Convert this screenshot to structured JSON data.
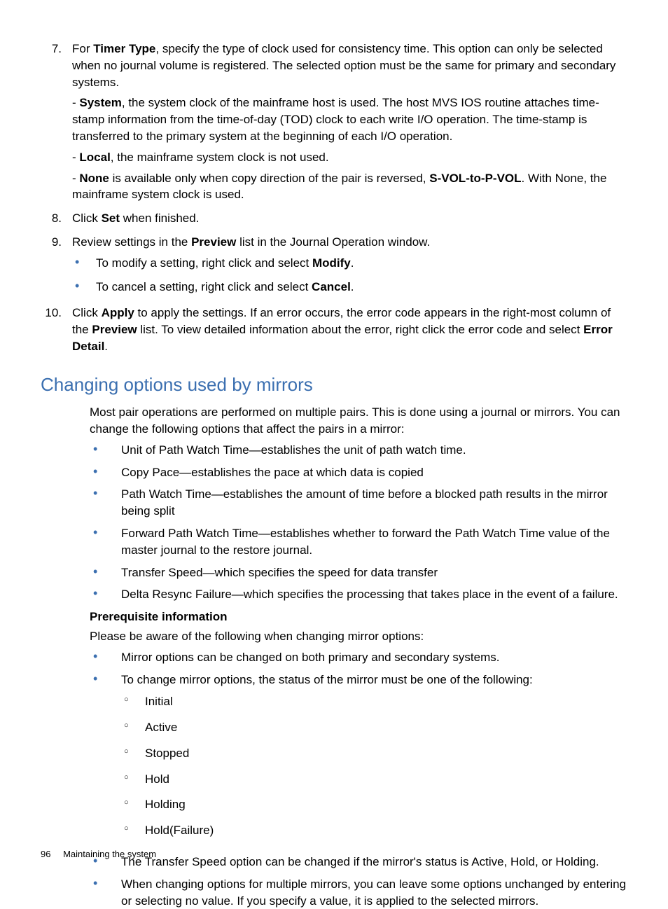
{
  "list7": {
    "num": "7.",
    "p1a": "For ",
    "p1b": "Timer Type",
    "p1c": ", specify the type of clock used for consistency time. This option can only be selected when no journal volume is registered. The selected option must be the same for primary and secondary systems.",
    "p2a": "- ",
    "p2b": "System",
    "p2c": ", the system clock of the mainframe host is used. The host MVS IOS routine attaches time-stamp information from the time-of-day (TOD) clock to each write I/O operation. The time-stamp is transferred to the primary system at the beginning of each I/O operation.",
    "p3a": "- ",
    "p3b": "Local",
    "p3c": ", the mainframe system clock is not used.",
    "p4a": "- ",
    "p4b": "None",
    "p4c": " is available only when copy direction of the pair is reversed, ",
    "p4d": "S-VOL-to-P-VOL",
    "p4e": ". With None, the mainframe system clock is used."
  },
  "list8": {
    "num": "8.",
    "t1": "Click ",
    "t2": "Set",
    "t3": " when finished."
  },
  "list9": {
    "num": "9.",
    "t1": "Review settings in the ",
    "t2": "Preview",
    "t3": " list in the Journal Operation window.",
    "sub1a": "To modify a setting, right click and select ",
    "sub1b": "Modify",
    "sub1c": ".",
    "sub2a": "To cancel a setting, right click and select ",
    "sub2b": "Cancel",
    "sub2c": "."
  },
  "list10": {
    "num": "10.",
    "t1": "Click ",
    "t2": "Apply",
    "t3": " to apply the settings. If an error occurs, the error code appears in the right-most column of the ",
    "t4": "Preview",
    "t5": " list. To view detailed information about the error, right click the error code and select ",
    "t6": "Error Detail",
    "t7": "."
  },
  "heading": "Changing options used by mirrors",
  "intro": "Most pair operations are performed on multiple pairs. This is done using a journal or mirrors. You can change the following options that affect the pairs in a mirror:",
  "opts": {
    "o1": "Unit of Path Watch Time—establishes the unit of path watch time.",
    "o2": "Copy Pace—establishes the pace at which data is copied",
    "o3": "Path Watch Time—establishes the amount of time before a blocked path results in the mirror being split",
    "o4": "Forward Path Watch Time—establishes whether to forward the Path Watch Time value of the master journal to the restore journal.",
    "o5": "Transfer Speed—which specifies the speed for data transfer",
    "o6": "Delta Resync Failure—which specifies the processing that takes place in the event of a failure."
  },
  "prereq_label": "Prerequisite information",
  "prereq_intro": "Please be aware of the following when changing mirror options:",
  "prereq": {
    "b1": "Mirror options can be changed on both primary and secondary systems.",
    "b2": "To change mirror options, the status of the mirror must be one of the following:",
    "statuses": {
      "s1": "Initial",
      "s2": "Active",
      "s3": "Stopped",
      "s4": "Hold",
      "s5": "Holding",
      "s6": "Hold(Failure)"
    },
    "b3": "The Transfer Speed option can be changed if the mirror's status is Active, Hold, or Holding.",
    "b4": "When changing options for multiple mirrors, you can leave some options unchanged by entering or selecting no value. If you specify a value, it is applied to the selected mirrors."
  },
  "footer": {
    "page": "96",
    "title": "Maintaining the system"
  }
}
